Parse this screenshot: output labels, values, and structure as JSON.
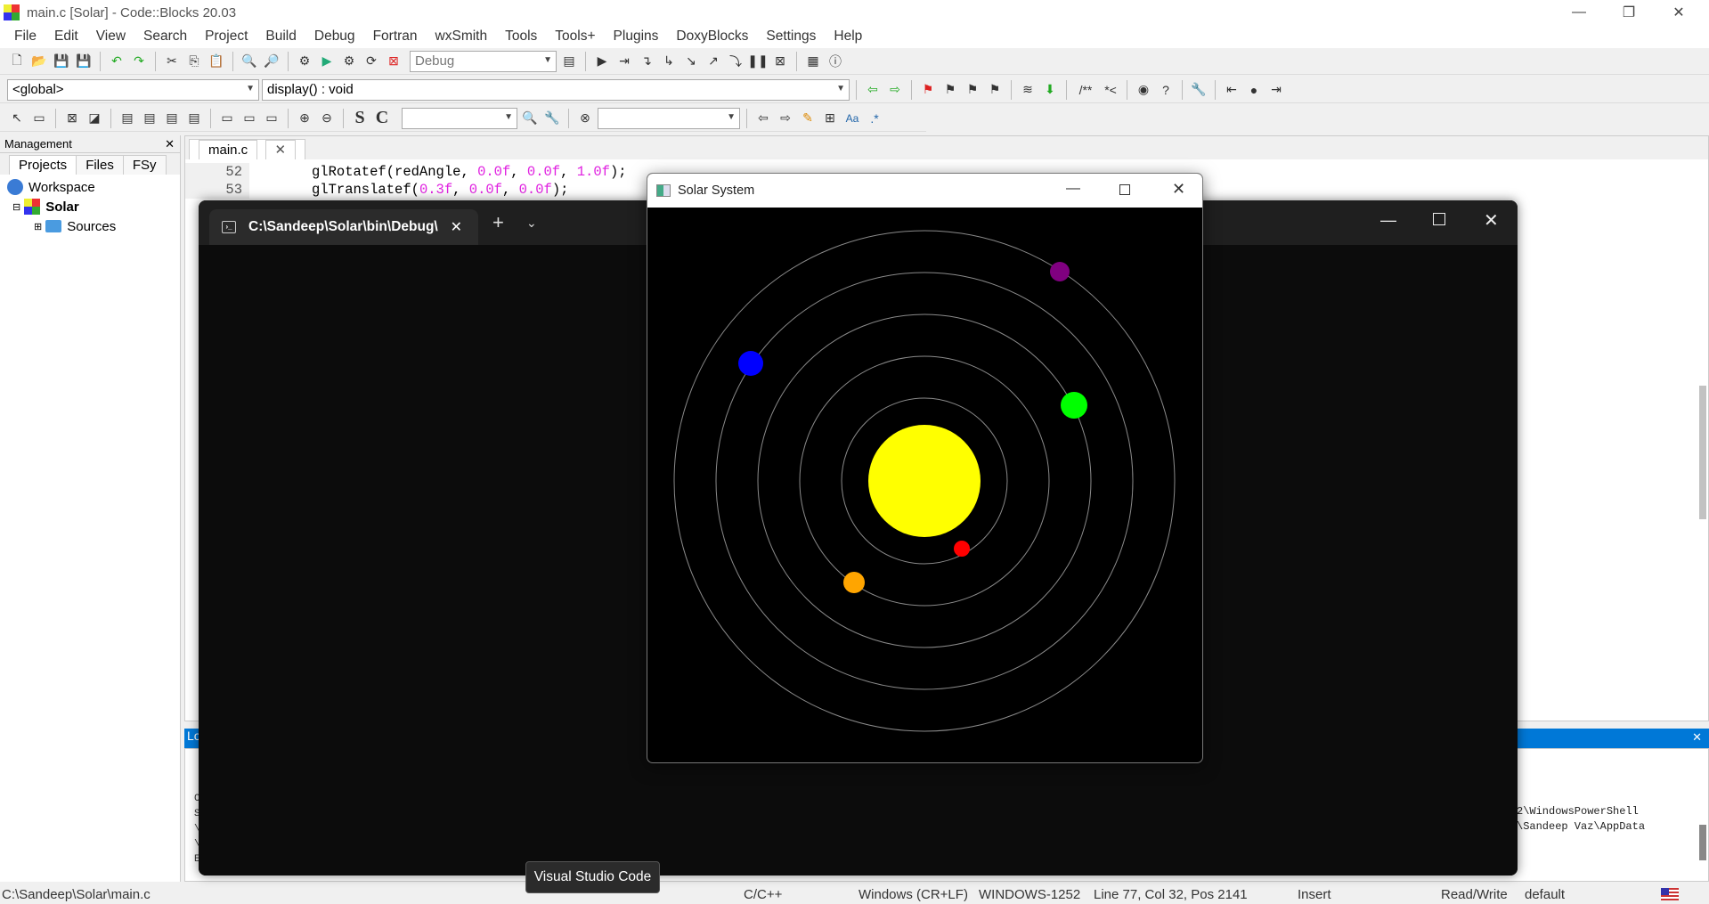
{
  "window": {
    "title": "main.c [Solar] - Code::Blocks 20.03"
  },
  "menu": [
    "File",
    "Edit",
    "View",
    "Search",
    "Project",
    "Build",
    "Debug",
    "Fortran",
    "wxSmith",
    "Tools",
    "Tools+",
    "Plugins",
    "DoxyBlocks",
    "Settings",
    "Help"
  ],
  "toolbar": {
    "build_target": "Debug",
    "scope": "<global>",
    "function": "display() : void",
    "doxy1": "/**",
    "doxy2": "*<",
    "regex": ".*",
    "aa": "Aa"
  },
  "management": {
    "title": "Management",
    "tabs": [
      "Projects",
      "Files",
      "FSy"
    ],
    "tree": {
      "workspace": "Workspace",
      "project": "Solar",
      "folder": "Sources"
    }
  },
  "editor": {
    "tab": "main.c",
    "lines": [
      {
        "num": "52",
        "fn": "glRotatef",
        "args": [
          "redAngle",
          "0.0f",
          "0.0f",
          "1.0f"
        ],
        "end": ");"
      },
      {
        "num": "53",
        "fn": "glTranslatef",
        "args": [
          "0.3f",
          "0.0f",
          "0.0f"
        ],
        "end": ");"
      }
    ]
  },
  "logs": {
    "tab": "Lo",
    "left_chars": [
      "C",
      "S",
      "\\",
      "\\",
      "E"
    ],
    "right_lines": [
      "2\\WindowsPowerShell",
      "\\Sandeep Vaz\\AppData"
    ]
  },
  "terminal": {
    "tab_title": "C:\\Sandeep\\Solar\\bin\\Debug\\"
  },
  "solar": {
    "title": "Solar System",
    "colors": {
      "sun": "#ffff00",
      "orbit": "#8a8a8a"
    },
    "planets": [
      {
        "name": "red",
        "color": "#ff0000"
      },
      {
        "name": "orange",
        "color": "#ffa500"
      },
      {
        "name": "green",
        "color": "#00ff00"
      },
      {
        "name": "blue",
        "color": "#0000ff"
      },
      {
        "name": "purple",
        "color": "#800080"
      }
    ]
  },
  "tooltip": "Visual Studio Code",
  "status": {
    "path": "C:\\Sandeep\\Solar\\main.c",
    "lang": "C/C++",
    "eol": "Windows (CR+LF)",
    "encoding": "WINDOWS-1252",
    "position": "Line 77, Col 32, Pos 2141",
    "mode": "Insert",
    "access": "Read/Write",
    "profile": "default"
  }
}
